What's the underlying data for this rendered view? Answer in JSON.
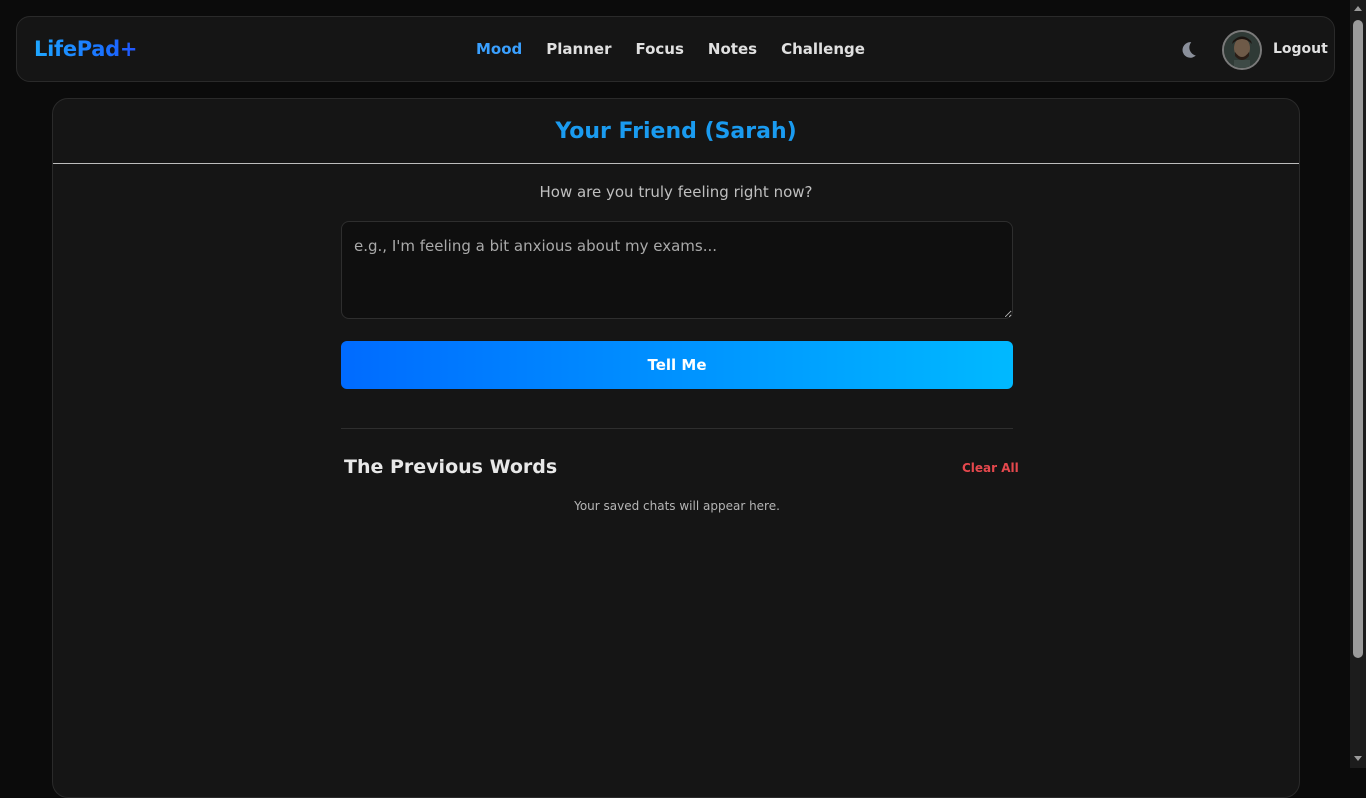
{
  "brand": {
    "name": "LifePad+"
  },
  "nav": {
    "items": [
      {
        "label": "Mood",
        "active": true
      },
      {
        "label": "Planner",
        "active": false
      },
      {
        "label": "Focus",
        "active": false
      },
      {
        "label": "Notes",
        "active": false
      },
      {
        "label": "Challenge",
        "active": false
      }
    ],
    "theme_icon": "moon-icon",
    "logout_label": "Logout"
  },
  "card": {
    "title": "Your Friend (Sarah)",
    "prompt": "How are you truly feeling right now?",
    "input_placeholder": "e.g., I'm feeling a bit anxious about my exams...",
    "input_value": "",
    "submit_label": "Tell Me"
  },
  "history": {
    "title": "The Previous Words",
    "clear_label": "Clear All",
    "empty_text": "Your saved chats will appear here."
  },
  "colors": {
    "accent": "#1a9bf0",
    "button_gradient_start": "#006bff",
    "button_gradient_end": "#00b9ff",
    "danger": "#e5484d",
    "background": "#0b0b0b",
    "surface": "#151515"
  }
}
